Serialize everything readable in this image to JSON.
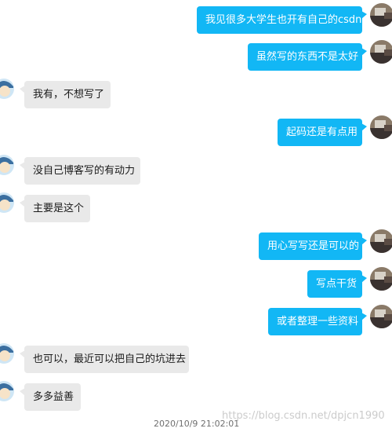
{
  "messages": [
    {
      "side": "out",
      "text": "我见很多大学生也开有自己的csdn"
    },
    {
      "side": "out",
      "text": "虽然写的东西不是太好"
    },
    {
      "side": "in",
      "text": "我有，不想写了"
    },
    {
      "side": "out",
      "text": "起码还是有点用"
    },
    {
      "side": "in",
      "text": "没自己博客写的有动力"
    },
    {
      "side": "in",
      "text": "主要是这个"
    },
    {
      "side": "out",
      "text": "用心写写还是可以的"
    },
    {
      "side": "out",
      "text": "写点干货"
    },
    {
      "side": "out",
      "text": "或者整理一些资料"
    },
    {
      "side": "in",
      "text": "也可以，最近可以把自己的坑进去"
    },
    {
      "side": "in",
      "text": "多多益善"
    }
  ],
  "timestamp": "2020/10/9 21:02:01",
  "watermark": "https://blog.csdn.net/dpjcn1990",
  "colors": {
    "outgoing_bubble": "#12b7f5",
    "incoming_bubble": "#e9e9e9"
  }
}
